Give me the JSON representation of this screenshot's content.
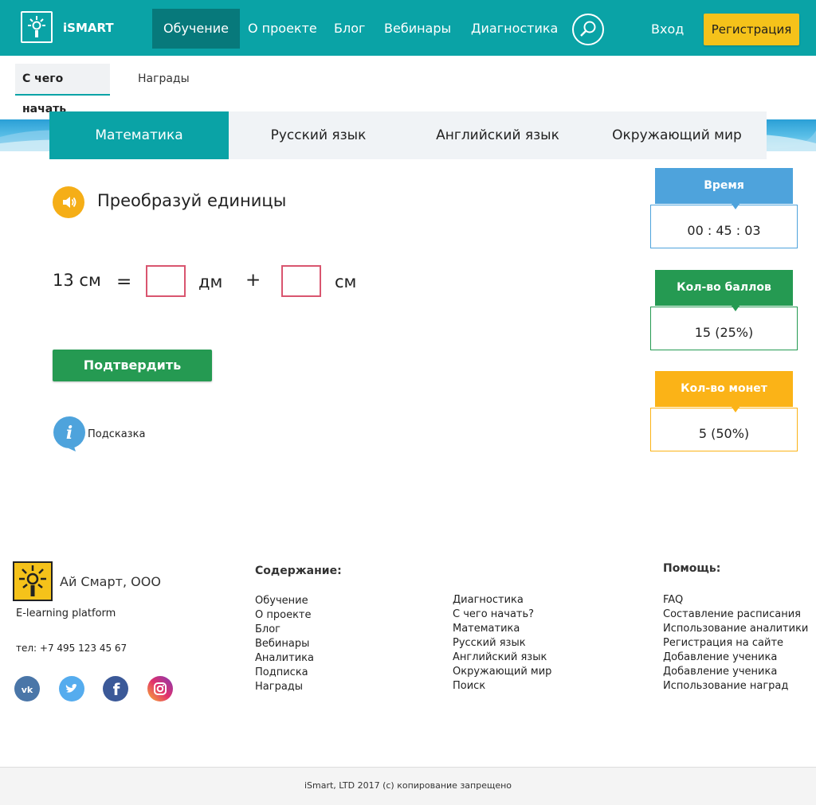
{
  "header": {
    "logo_text": "iSMART",
    "nav": [
      "Обучение",
      "О проекте",
      "Блог",
      "Вебинары",
      "Диагностика"
    ],
    "login": "Вход",
    "register": "Регистрация"
  },
  "subtabs": [
    "С чего начать",
    "Награды"
  ],
  "subjects": [
    "Математика",
    "Русский язык",
    "Английский язык",
    "Окружающий мир"
  ],
  "task": {
    "title": "Преобразуй единицы",
    "lhs": "13 см",
    "eq": "=",
    "unit1": "дм",
    "plus": "+",
    "unit2": "см",
    "confirm": "Подтвердить",
    "hint": "Подсказка"
  },
  "stats": {
    "time_label": "Время",
    "time_value": "00 : 45 : 03",
    "points_label": "Кол-во баллов",
    "points_value": "15 (25%)",
    "coins_label": "Кол-во монет",
    "coins_value": "5 (50%)"
  },
  "colors": {
    "accent": "#0aa3a6",
    "time": "#4ea3dc",
    "points": "#259a52",
    "coins": "#fbb317"
  },
  "footer": {
    "company": "Ай Смарт, ООО",
    "tagline": "E-learning platform",
    "phone": "тел: +7 495 123 45 67",
    "contents_title": "Содержание:",
    "col1": [
      "Обучение",
      "О проекте",
      "Блог",
      "Вебинары",
      "Аналитика",
      "Подписка",
      "Награды"
    ],
    "col2": [
      "Диагностика",
      "С чего начать?",
      "Математика",
      "Русский язык",
      "Английский язык",
      "Окружающий мир",
      "Поиск"
    ],
    "help_title": "Помощь:",
    "col3": [
      "FAQ",
      "Составление расписания",
      "Использование аналитики",
      "Регистрация на сайте",
      "Добавление ученика",
      "Добавление ученика",
      "Использование наград"
    ],
    "copyright": "iSmart, LTD 2017 (с) копирование запрещено"
  }
}
